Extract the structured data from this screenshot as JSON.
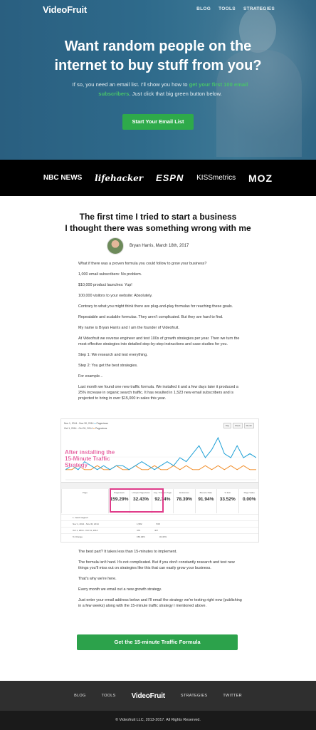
{
  "header": {
    "logo": "VideoFruit",
    "nav": [
      "BLOG",
      "TOOLS",
      "STRATEGIES"
    ]
  },
  "hero": {
    "title_line1": "Want random people on the",
    "title_line2": "internet to buy stuff from you?",
    "subtitle_pre": "If so, you need an email list. I'll show you how to ",
    "subtitle_highlight": "get your first 100 email subscribers",
    "subtitle_post": ". Just click that big green button below.",
    "cta": "Start Your Email List"
  },
  "press_logos": [
    "NBC NEWS",
    "lifehacker",
    "ESPN",
    "KISSmetrics",
    "MOZ"
  ],
  "article": {
    "title_line1": "The first time I tried to start a business",
    "title_line2": "I thought there was something wrong with me",
    "author": "Bryan Harris, March 18th, 2017",
    "paragraphs": [
      "What if there was a proven formula you could follow to grow your business?",
      "1,000 email subscribers: No problem.",
      "$10,000 product launches: Yup!",
      "100,000 visitors to your website: Absolutely.",
      "Contrary to what you might think there are plug-and-play formulas for reaching these goals.",
      "Repeatable and scalable formulas. They aren't complicated. But they are hard to find.",
      "My name is Bryan Harris and I am the founder of Videofruit.",
      "At Videofruit we reverse engineer and test 100s of growth strategies per year. Then we turn the most effective strategies into detailed step-by-step instructions and case studies for you.",
      "Step 1: We research and test everything.",
      "Step 2: You get the best strategies.",
      "For example...",
      "Last month we found one new traffic formula. We installed it and a few days later it produced a 25% increase in organic search traffic. It has resulted in 1,523 new email subscribers and is projected to bring in over $15,000 in sales this year."
    ],
    "paragraphs2": [
      "The best part? It takes less than 15-minutes to implement.",
      "The formula isn't hard. It's not complicated. But if you don't constantly research and test new things you'll miss out on strategies like this that can easily grow your business.",
      "That's why we're here.",
      "Every month we email out a new growth strategy.",
      "Just enter your email address below and I'll email the strategy we're testing right now (publishing in a few weeks) along with the 15-minute traffic strategy I mentioned above."
    ],
    "cta": "Get the 15-minute Traffic Formula"
  },
  "screenshot": {
    "date_range_1": "Nov 1, 2014 - Nov 30, 2014",
    "date_range_2": "Oct 1, 2014 - Oct 31, 2014",
    "legend": "Pageviews",
    "buttons": [
      "Day",
      "Week",
      "Month"
    ],
    "annotation": [
      "After installing the",
      "15-Minute Traffic",
      "Strategy"
    ],
    "metrics": [
      {
        "label": "Page",
        "value": ""
      },
      {
        "label": "Pageviews",
        "value": "159.29%"
      },
      {
        "label": "Unique Pageviews",
        "value": "32.43%"
      },
      {
        "label": "Avg. Time on Page",
        "value": "92.34%"
      },
      {
        "label": "Entrances",
        "value": "78.39%"
      },
      {
        "label": "Bounce Rate",
        "value": "91.94%"
      },
      {
        "label": "% Exit",
        "value": "33.52%"
      },
      {
        "label": "Page Value",
        "value": "0.00%"
      }
    ],
    "rows": [
      [
        "1. /lead-magnet/",
        "",
        ""
      ],
      [
        "Nov 1, 2014 - Nov 30, 2014",
        "1,582",
        "538"
      ],
      [
        "Oct 1, 2014 - Oct 31, 2014",
        "476",
        "407"
      ],
      [
        "% Change",
        "159.29%",
        "32.43%"
      ]
    ],
    "chart_series_nov": [
      2,
      3,
      2,
      4,
      3,
      2,
      3,
      2,
      3,
      3,
      2,
      3,
      4,
      3,
      2,
      3,
      4,
      3,
      5,
      4,
      6,
      8,
      5,
      7,
      10,
      6,
      5,
      8,
      5,
      6,
      5
    ],
    "chart_series_oct": [
      2,
      2,
      3,
      2,
      2,
      3,
      2,
      2,
      3,
      2,
      2,
      3,
      2,
      2,
      3,
      2,
      2,
      3,
      2,
      3,
      2,
      2,
      3,
      2,
      3,
      2,
      3,
      2,
      3,
      2,
      2
    ]
  },
  "footer": {
    "links_left": [
      "BLOG",
      "TOOLS"
    ],
    "logo": "VideoFruit",
    "links_right": [
      "STRATEGIES",
      "TWITTER"
    ],
    "copyright": "© Videofruit LLC, 2013-2017. All Rights Reserved."
  },
  "colors": {
    "hero_bg": "#2e6a8b",
    "cta_green": "#2eaa4a",
    "annotation_pink": "#e03c8a",
    "series_nov": "#1fa0d6",
    "series_oct": "#f08a24"
  }
}
